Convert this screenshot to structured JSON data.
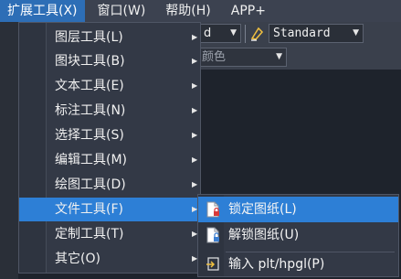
{
  "menubar": {
    "items": [
      {
        "label": "扩展工具(X)"
      },
      {
        "label": "窗口(W)"
      },
      {
        "label": "帮助(H)"
      },
      {
        "label": "APP+"
      }
    ]
  },
  "toolbar": {
    "left_combo_value": "d",
    "style_combo_value": "Standard",
    "color_combo_value": "颜色"
  },
  "ext_menu": {
    "items": [
      {
        "label": "图层工具(L)"
      },
      {
        "label": "图块工具(B)"
      },
      {
        "label": "文本工具(E)"
      },
      {
        "label": "标注工具(N)"
      },
      {
        "label": "选择工具(S)"
      },
      {
        "label": "编辑工具(M)"
      },
      {
        "label": "绘图工具(D)"
      },
      {
        "label": "文件工具(F)"
      },
      {
        "label": "定制工具(T)"
      },
      {
        "label": "其它(O)"
      }
    ],
    "highlighted_index": 7
  },
  "file_submenu": {
    "items": [
      {
        "label": "锁定图纸(L)",
        "icon": "lock-drawing-icon"
      },
      {
        "label": "解锁图纸(U)",
        "icon": "unlock-drawing-icon"
      },
      {
        "label": "输入 plt/hpgl(P)",
        "icon": "import-plt-icon"
      }
    ],
    "highlighted_index": 0
  },
  "colors": {
    "accent": "#2d7fd6",
    "menubar_active": "#2d6eb6",
    "menu_bg": "#333946"
  }
}
